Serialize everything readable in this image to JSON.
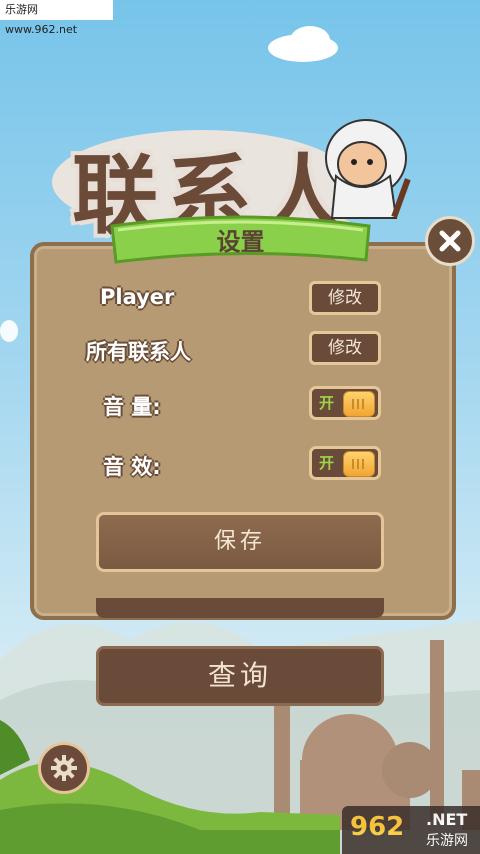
{
  "watermark_top": "乐游网 www.962.net",
  "title": "联系人",
  "dialog": {
    "title": "设置",
    "rows": [
      {
        "label": "Player",
        "button": "修改"
      },
      {
        "label": "所有联系人",
        "button": "修改"
      }
    ],
    "volume_label": "音 量:",
    "volume_toggle": "开",
    "effects_label": "音 效:",
    "effects_toggle": "开",
    "save_label": "保存",
    "close_icon": "close-icon"
  },
  "query_label": "查询",
  "settings_icon": "gear-icon",
  "watermark_bottom": {
    "number": "962",
    "net": ".NET",
    "cn": "乐游网"
  },
  "colors": {
    "panel": "#b59a74",
    "button": "#6a4a38",
    "banner": "#8bd04a",
    "accent": "#f1a532"
  }
}
